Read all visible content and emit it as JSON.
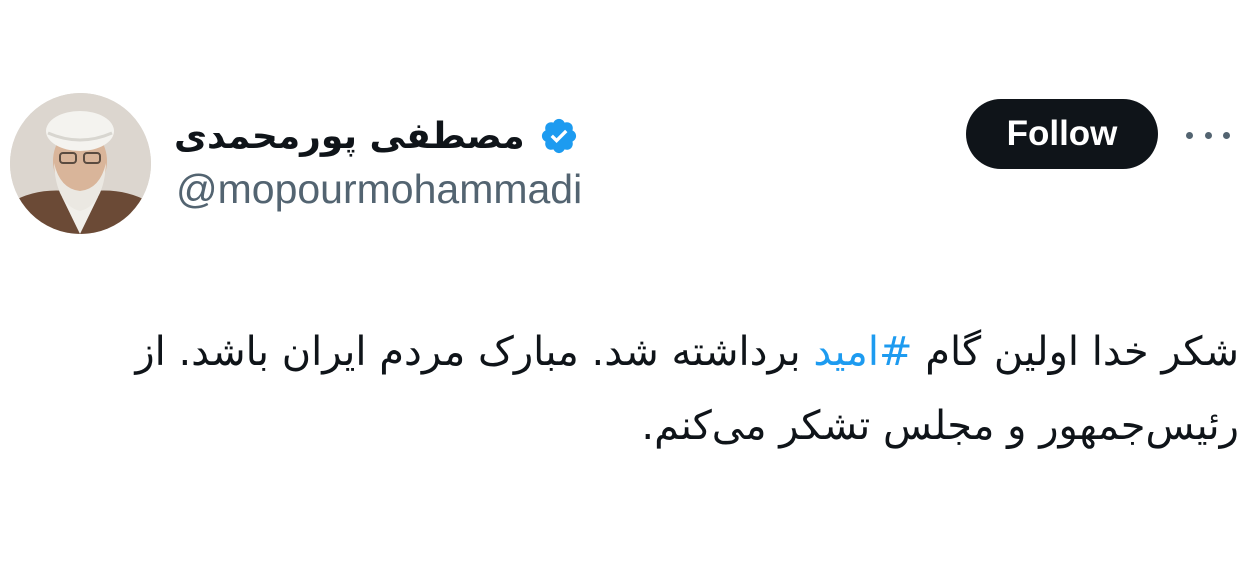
{
  "author": {
    "display_name": "مصطفی پورمحمدی",
    "handle": "@mopourmohammadi",
    "verified_icon": "verified-badge-icon",
    "verified_color": "#1d9bf0"
  },
  "actions": {
    "follow_label": "Follow",
    "more_icon": "more-horizontal-icon"
  },
  "tweet": {
    "text_before": "شکر خدا اولین گام ",
    "hashtag": "#امید",
    "text_after": " برداشته شد. مبارک مردم ایران باشد. از رئیس‌جمهور و مجلس تشکر می‌کنم.",
    "hashtag_color": "#1d9bf0"
  }
}
